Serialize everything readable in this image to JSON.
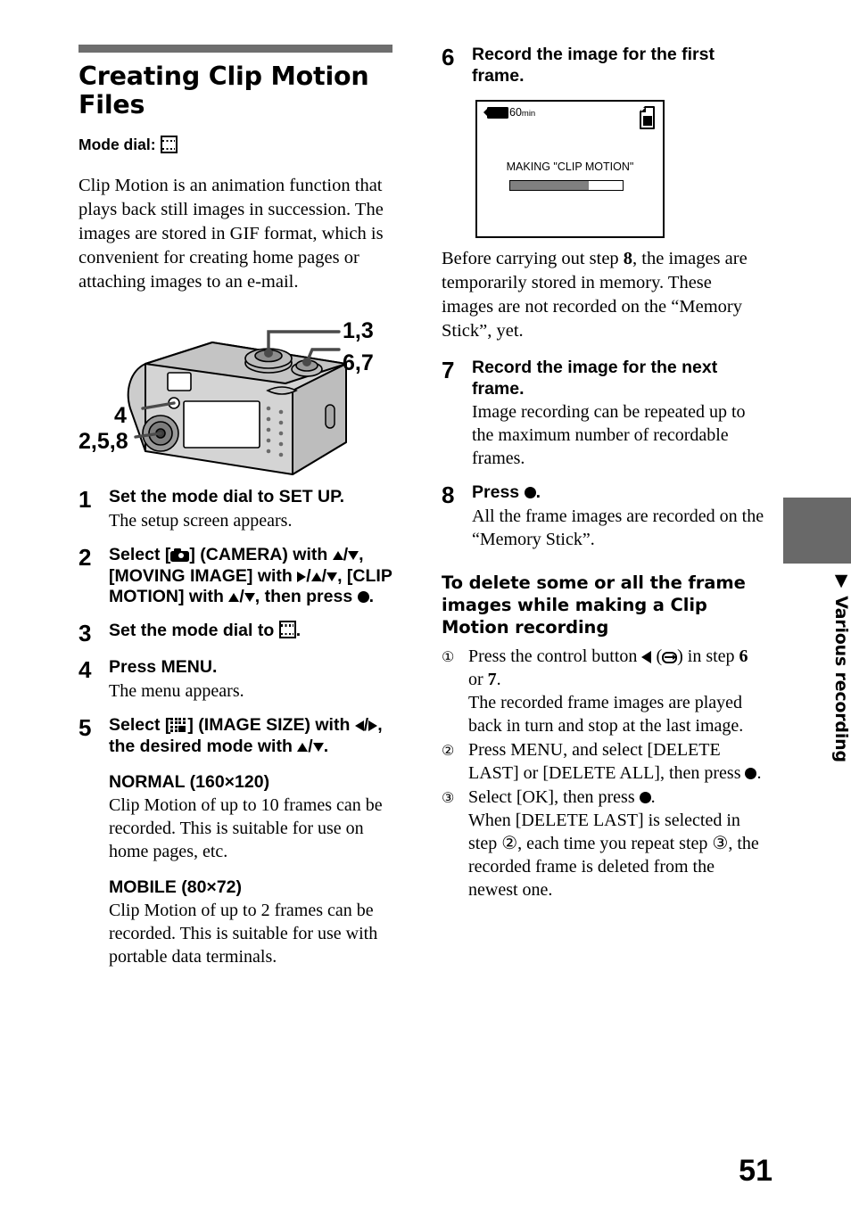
{
  "heading": {
    "title": "Creating Clip Motion Files",
    "mode_dial_label": "Mode dial:",
    "mode_dial_icon": "film-strip-icon"
  },
  "intro": "Clip Motion is an animation function that plays back still images in succession. The images are stored in GIF format, which is convenient for creating home pages or attaching images to an e-mail.",
  "figure": {
    "name": "camera-rear-illustration",
    "callouts": [
      {
        "id": "c13",
        "label": "1,3"
      },
      {
        "id": "c67",
        "label": "6,7"
      },
      {
        "id": "c4",
        "label": "4"
      },
      {
        "id": "c258",
        "label": "2,5,8"
      }
    ]
  },
  "steps_left": [
    {
      "num": "1",
      "title": "Set the mode dial to SET UP.",
      "desc": "The setup screen appears."
    },
    {
      "num": "2",
      "title_parts": {
        "p1": "Select [",
        "p2": "] (CAMERA) with ",
        "p3": "/",
        "p4": ", [MOVING IMAGE] with ",
        "p5": "/",
        "p6": "/",
        "p7": ", [CLIP MOTION] with ",
        "p8": "/",
        "p9": ", then press ",
        "p10": "."
      }
    },
    {
      "num": "3",
      "title_parts": {
        "p1": "Set the mode dial to ",
        "p2": "."
      }
    },
    {
      "num": "4",
      "title": "Press MENU.",
      "desc": "The menu appears."
    },
    {
      "num": "5",
      "title_parts": {
        "p1": "Select [",
        "p2": "] (IMAGE SIZE) with ",
        "p3": "/",
        "p4": ", the desired mode with ",
        "p5": "/",
        "p6": "."
      }
    }
  ],
  "modes": [
    {
      "name": "NORMAL (160×120)",
      "text": "Clip Motion of up to 10 frames can be recorded. This is suitable for use on home pages, etc."
    },
    {
      "name": "MOBILE (80×72)",
      "text": "Clip Motion of up to 2 frames can be recorded. This is suitable for use with portable data terminals."
    }
  ],
  "steps_right": [
    {
      "num": "6",
      "title": "Record the image for the first frame."
    },
    {
      "num": "7",
      "title": "Record the image for the next frame.",
      "desc": "Image recording can be repeated up to the maximum number of recordable frames."
    },
    {
      "num": "8",
      "title_parts": {
        "p1": "Press ",
        "p2": "."
      },
      "desc": "All the frame images are recorded on the “Memory Stick”."
    }
  ],
  "lcd": {
    "battery_value": "60",
    "battery_unit": "min",
    "message": "MAKING \"CLIP MOTION\"",
    "progress_percent": 70,
    "progress_fill_color": "#808080",
    "memory_stick_icon": "memory-stick-icon",
    "battery_icon": "battery-icon"
  },
  "note_after_lcd": {
    "p1": "Before carrying out step ",
    "step_ref": "8",
    "p2": ", the images are temporarily stored in memory. These images are not recorded on the “Memory Stick”, yet."
  },
  "delete_section": {
    "heading": "To delete some or all the frame images while making a Clip Motion recording",
    "items": [
      {
        "marker": "①",
        "parts": {
          "p1": "Press the control button ",
          "p2": " (",
          "p3": ") in step ",
          "ref1": "6",
          "p4": " or ",
          "ref2": "7",
          "p5": "."
        },
        "desc": "The recorded frame images are played back in turn and stop at the last image."
      },
      {
        "marker": "②",
        "parts": {
          "p1": "Press MENU, and select [DELETE LAST] or [DELETE ALL], then press ",
          "p2": "."
        }
      },
      {
        "marker": "③",
        "parts": {
          "p1": "Select [OK], then press ",
          "p2": "."
        },
        "desc_parts": {
          "d1": "When [DELETE LAST] is selected in step ",
          "m1": "②",
          "d2": ", each time you repeat step ",
          "m2": "③",
          "d3": ", the recorded frame is deleted from the newest one."
        }
      }
    ]
  },
  "side_tab": {
    "label": "▼ Various recording",
    "color": "#696969"
  },
  "page_number": "51"
}
